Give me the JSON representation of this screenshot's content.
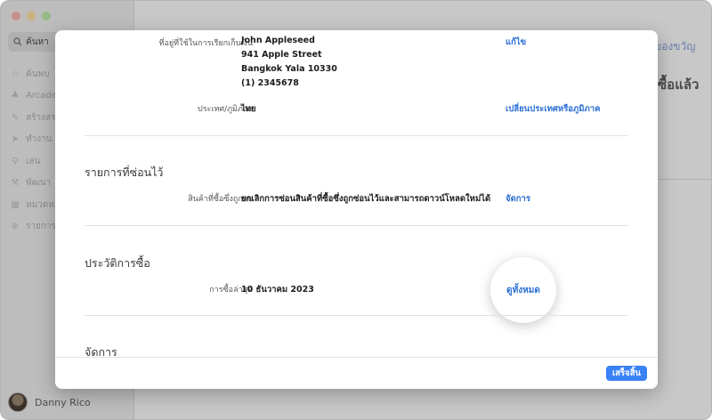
{
  "sidebar": {
    "search_placeholder": "ค้นหา",
    "items": [
      {
        "label": "ค้นพบ",
        "icon": "star-icon"
      },
      {
        "label": "Arcade",
        "icon": "arcade-icon"
      },
      {
        "label": "สร้างสรรค์",
        "icon": "brush-icon"
      },
      {
        "label": "ทำงาน",
        "icon": "paper-plane-icon"
      },
      {
        "label": "เล่น",
        "icon": "rocket-icon"
      },
      {
        "label": "พัฒนา",
        "icon": "hammer-icon"
      },
      {
        "label": "หมวดหมู่",
        "icon": "grid-icon"
      },
      {
        "label": "รายการอัปเดต",
        "icon": "update-icon"
      }
    ],
    "user_name": "Danny Rico"
  },
  "background": {
    "link_text": "ของขวัญ",
    "heading": "ซื้อแล้ว"
  },
  "modal": {
    "billing": {
      "label": "ที่อยู่ที่ใช้ในการเรียกเก็บเงิน",
      "lines": [
        "John Appleseed",
        "941 Apple Street",
        "Bangkok Yala 10330",
        "(1) 2345678"
      ],
      "edit_link": "แก้ไข"
    },
    "country": {
      "label": "ประเทศ/ภูมิภาค",
      "value": "ไทย",
      "link": "เปลี่ยนประเทศหรือภูมิภาค"
    },
    "hidden_section": {
      "title": "รายการที่ซ่อนไว้",
      "label": "สินค้าที่ซื้อซึ่งถูกลบ",
      "value": "ยกเลิกการซ่อนสินค้าที่ซื้อซึ่งถูกซ่อนไว้และสามารถดาวน์โหลดใหม่ได้",
      "link": "จัดการ"
    },
    "history_section": {
      "title": "ประวัติการซื้อ",
      "label": "การซื้อล่าสุด",
      "value": "10 ธันวาคม 2023",
      "link": "ดูทั้งหมด"
    },
    "manage_section": {
      "title": "จัดการ"
    },
    "done_button": "เสร็จสิ้น"
  },
  "colors": {
    "accent": "#2a6fd6",
    "button": "#3b82f6"
  }
}
